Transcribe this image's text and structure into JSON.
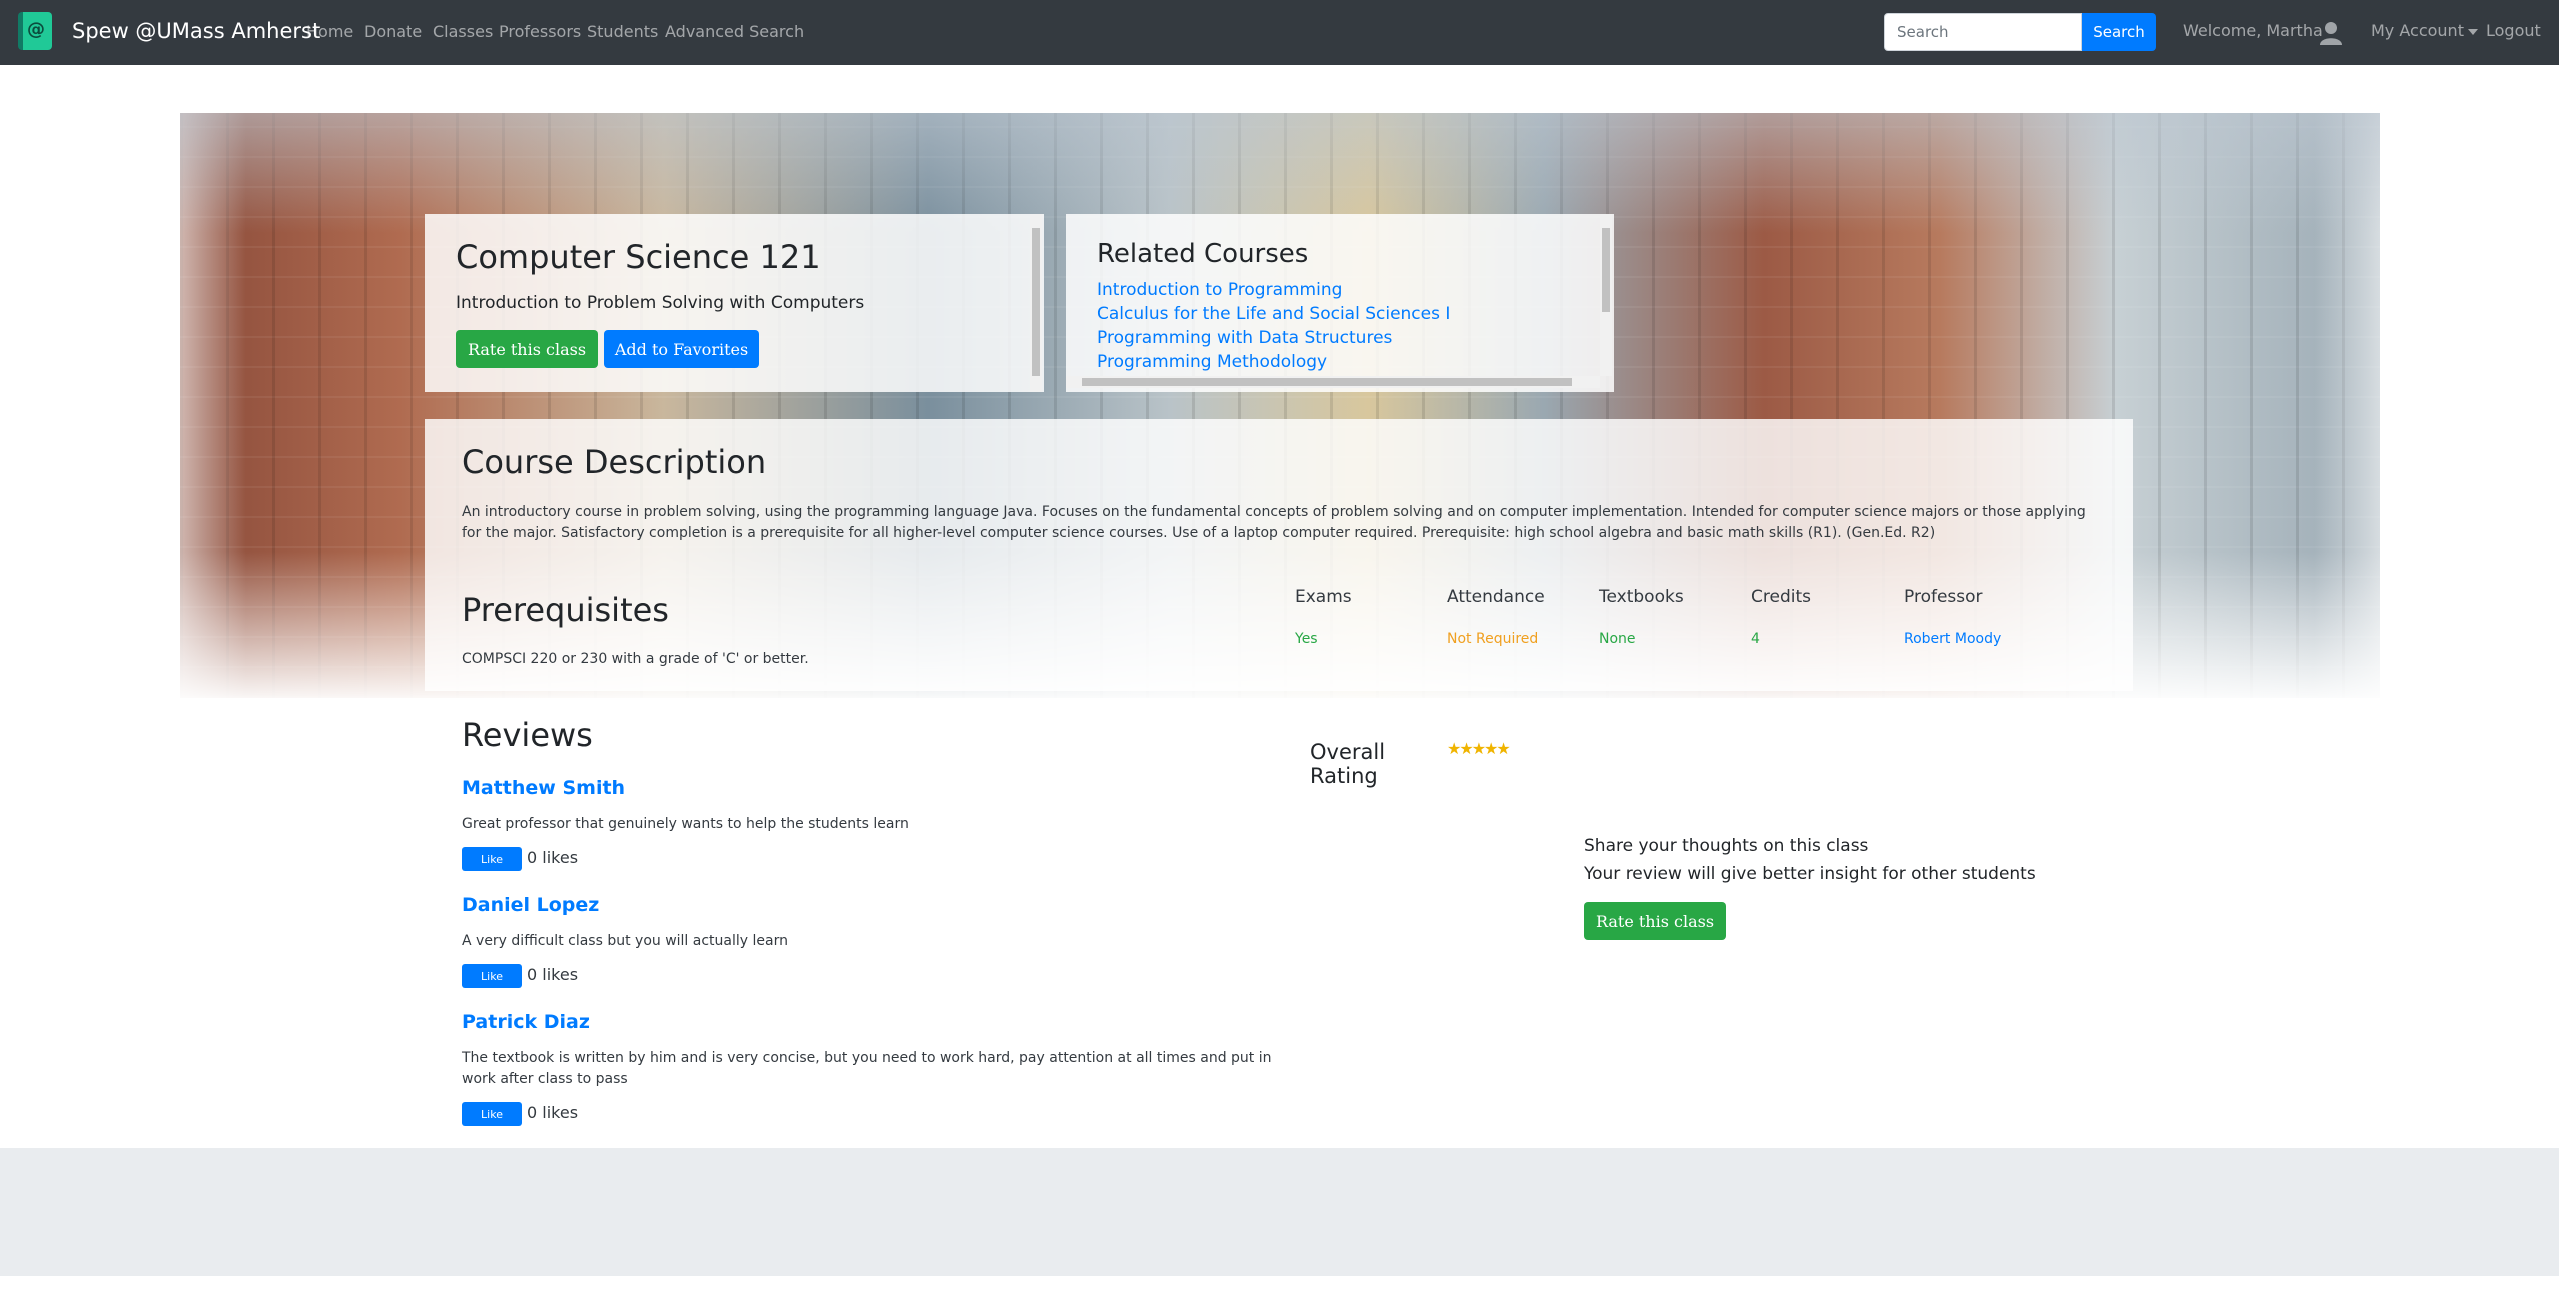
{
  "navbar": {
    "brand": "Spew @UMass Amherst",
    "links": [
      "Home",
      "Donate",
      "Classes",
      "Professors",
      "Students",
      "Advanced Search"
    ],
    "search_placeholder": "Search",
    "search_button": "Search",
    "welcome": "Welcome, Martha",
    "account": "My Account",
    "logout": "Logout"
  },
  "course": {
    "title": "Computer Science 121",
    "subtitle": "Introduction to Problem Solving with Computers",
    "rate_button": "Rate this class",
    "favorite_button": "Add to Favorites"
  },
  "related": {
    "title": "Related Courses",
    "links": [
      "Introduction to Programming",
      "Calculus for the Life and Social Sciences I",
      "Programming with Data Structures",
      "Programming Methodology"
    ]
  },
  "description": {
    "title": "Course Description",
    "text": "An introductory course in problem solving, using the programming language Java. Focuses on the fundamental concepts of problem solving and on computer implementation. Intended for computer science majors or those applying for the major. Satisfactory completion is a prerequisite for all higher-level computer science courses. Use of a laptop computer required. Prerequisite: high school algebra and basic math skills (R1). (Gen.Ed. R2)"
  },
  "prerequisites": {
    "title": "Prerequisites",
    "text": "COMPSCI 220 or 230 with a grade of 'C' or better."
  },
  "stats": [
    {
      "label": "Exams",
      "value": "Yes",
      "color": "#28a745"
    },
    {
      "label": "Attendance",
      "value": "Not Required",
      "color": "#f0a020"
    },
    {
      "label": "Textbooks",
      "value": "None",
      "color": "#28a745"
    },
    {
      "label": "Credits",
      "value": "4",
      "color": "#28a745"
    },
    {
      "label": "Professor",
      "value": "Robert Moody",
      "color": "#007bff"
    }
  ],
  "reviews": {
    "title": "Reviews",
    "like_label": "Like",
    "items": [
      {
        "name": "Matthew Smith",
        "text": "Great professor that genuinely wants to help the students learn",
        "likes": "0 likes"
      },
      {
        "name": "Daniel Lopez",
        "text": "A very difficult class but you will actually learn",
        "likes": "0 likes"
      },
      {
        "name": "Patrick Diaz",
        "text": "The textbook is written by him and is very concise, but you need to work hard, pay attention at all times and put in work after class to pass",
        "likes": "0 likes"
      }
    ]
  },
  "rating": {
    "label": "Overall Rating",
    "stars": "★★★★★",
    "value": 5,
    "max": 5
  },
  "share": {
    "line1": "Share your thoughts on this class",
    "line2": "Your review will give better insight for other students",
    "button": "Rate this class"
  },
  "colors": {
    "navbar": "#343a40",
    "primary": "#007bff",
    "success": "#28a745",
    "footer": "#e9ecef"
  }
}
